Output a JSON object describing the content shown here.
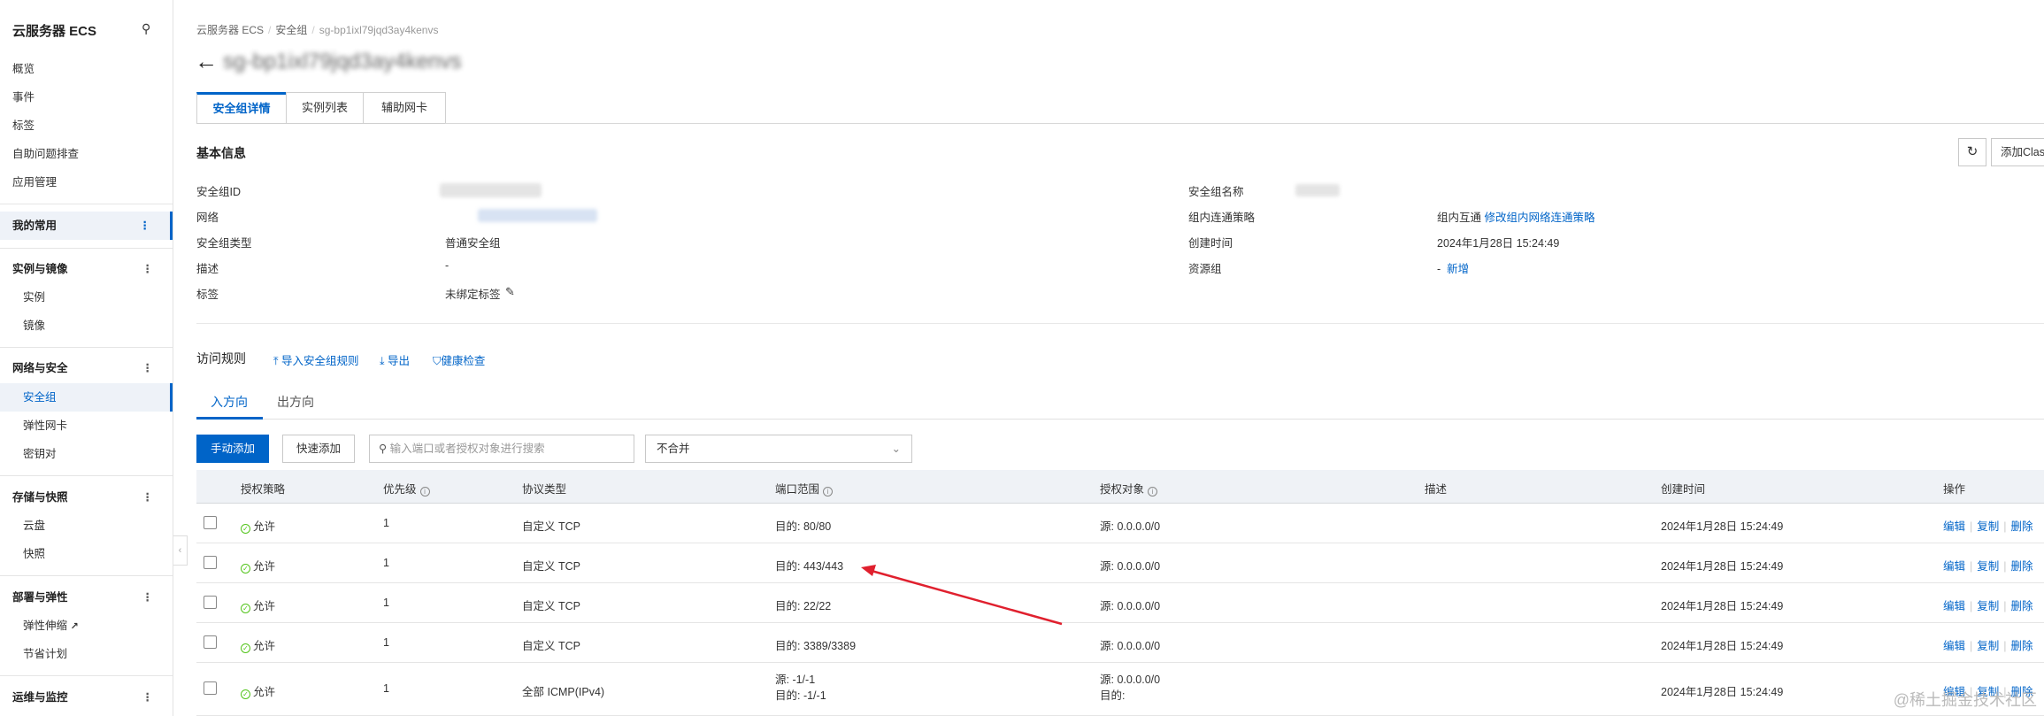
{
  "sidebar": {
    "title": "云服务器 ECS",
    "top_items": [
      "概览",
      "事件",
      "标签",
      "自助问题排查",
      "应用管理"
    ],
    "favorites": "我的常用",
    "groups": [
      {
        "label": "实例与镜像",
        "items": [
          "实例",
          "镜像"
        ]
      },
      {
        "label": "网络与安全",
        "items": [
          "安全组",
          "弹性网卡",
          "密钥对"
        ]
      },
      {
        "label": "存储与快照",
        "items": [
          "云盘",
          "快照"
        ]
      },
      {
        "label": "部署与弹性",
        "items": [
          "弹性伸缩",
          "节省计划"
        ]
      },
      {
        "label": "运维与监控",
        "items": []
      }
    ],
    "more": "⋮"
  },
  "breadcrumb": [
    "云服务器 ECS",
    "安全组",
    "sg-bp1ixl79jqd3ay4kenvs"
  ],
  "page_title": "sg-bp1ixl79jqd3ay4kenvs",
  "tabs": [
    "安全组详情",
    "实例列表",
    "辅助网卡"
  ],
  "basic": {
    "heading": "基本信息",
    "add_button": "添加Clas",
    "left": [
      {
        "label": "安全组ID",
        "value": ""
      },
      {
        "label": "网络",
        "value": ""
      },
      {
        "label": "安全组类型",
        "value": "普通安全组"
      },
      {
        "label": "描述",
        "value": "-"
      },
      {
        "label": "标签",
        "value": "未绑定标签"
      }
    ],
    "right": [
      {
        "label": "安全组名称",
        "value": ""
      },
      {
        "label": "组内连通策略",
        "value": "组内互通",
        "link": "修改组内网络连通策略"
      },
      {
        "label": "创建时间",
        "value": "2024年1月28日 15:24:49"
      },
      {
        "label": "资源组",
        "value": "-",
        "link": "新增"
      }
    ]
  },
  "rules": {
    "heading": "访问规则",
    "actions": [
      "导入安全组规则",
      "导出",
      "健康检查"
    ],
    "direction_tabs": [
      "入方向",
      "出方向"
    ],
    "add_manual": "手动添加",
    "add_quick": "快速添加",
    "search_placeholder": "输入端口或者授权对象进行搜索",
    "merge_select": "不合并",
    "columns": [
      "授权策略",
      "优先级",
      "协议类型",
      "端口范围",
      "授权对象",
      "描述",
      "创建时间",
      "操作"
    ],
    "row_actions": [
      "编辑",
      "复制",
      "删除"
    ],
    "rows": [
      {
        "policy": "允许",
        "priority": "1",
        "protocol": "自定义 TCP",
        "port": [
          "目的: 80/80"
        ],
        "object": [
          "源: 0.0.0.0/0"
        ],
        "desc": "",
        "time": "2024年1月28日 15:24:49"
      },
      {
        "policy": "允许",
        "priority": "1",
        "protocol": "自定义 TCP",
        "port": [
          "目的: 443/443"
        ],
        "object": [
          "源: 0.0.0.0/0"
        ],
        "desc": "",
        "time": "2024年1月28日 15:24:49"
      },
      {
        "policy": "允许",
        "priority": "1",
        "protocol": "自定义 TCP",
        "port": [
          "目的: 22/22"
        ],
        "object": [
          "源: 0.0.0.0/0"
        ],
        "desc": "",
        "time": "2024年1月28日 15:24:49"
      },
      {
        "policy": "允许",
        "priority": "1",
        "protocol": "自定义 TCP",
        "port": [
          "目的: 3389/3389"
        ],
        "object": [
          "源: 0.0.0.0/0"
        ],
        "desc": "",
        "time": "2024年1月28日 15:24:49"
      },
      {
        "policy": "允许",
        "priority": "1",
        "protocol": "全部 ICMP(IPv4)",
        "port": [
          "源: -1/-1",
          "目的: -1/-1"
        ],
        "object": [
          "源: 0.0.0.0/0",
          "目的:"
        ],
        "desc": "",
        "time": "2024年1月28日 15:24:49"
      }
    ]
  },
  "watermark": "@稀土掘金技术社区",
  "colors": {
    "primary": "#0064c8",
    "annotation_arrow": "#e0202e",
    "allow": "#52c41a"
  }
}
